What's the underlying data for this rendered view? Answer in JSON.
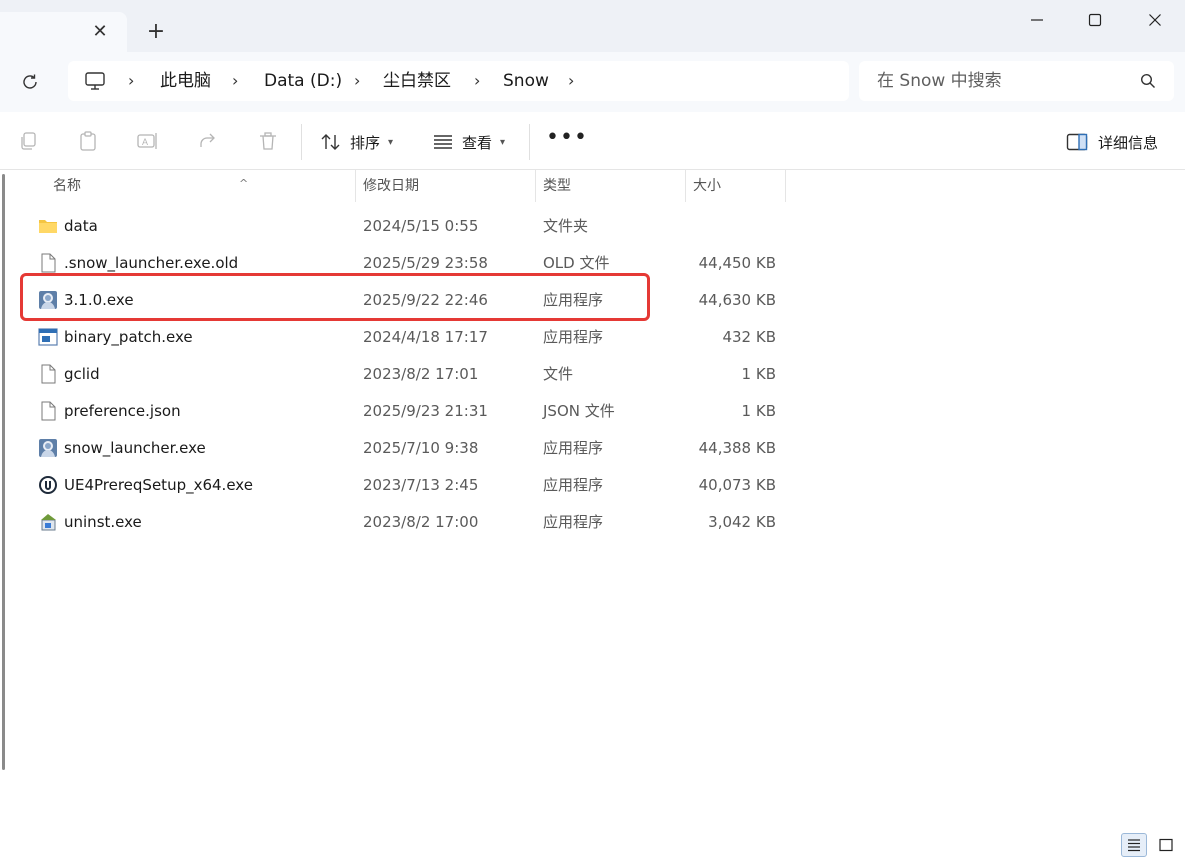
{
  "window": {
    "tab_close_glyph": "✕",
    "new_tab_glyph": "+",
    "controls": [
      "minimize-icon",
      "maximize-icon",
      "close-icon"
    ]
  },
  "breadcrumb": {
    "items": [
      "此电脑",
      "Data (D:)",
      "尘白禁区",
      "Snow"
    ],
    "separator": "›"
  },
  "search": {
    "placeholder": "在 Snow 中搜索"
  },
  "toolbar": {
    "icons": [
      "copy-icon",
      "paste-icon",
      "rename-icon",
      "share-icon",
      "delete-icon"
    ],
    "sort_label": "排序",
    "view_label": "查看",
    "more_label": "•••",
    "details_label": "详细信息"
  },
  "columns": {
    "name": "名称",
    "date": "修改日期",
    "type": "类型",
    "size": "大小"
  },
  "files": [
    {
      "name": "data",
      "date": "2024/5/15 0:55",
      "type": "文件夹",
      "size": "",
      "icon": "folder-icon"
    },
    {
      "name": ".snow_launcher.exe.old",
      "date": "2025/5/29 23:58",
      "type": "OLD 文件",
      "size": "44,450 KB",
      "icon": "file-icon"
    },
    {
      "name": "3.1.0.exe",
      "date": "2025/9/22 22:46",
      "type": "应用程序",
      "size": "44,630 KB",
      "icon": "launcher-app-icon"
    },
    {
      "name": "binary_patch.exe",
      "date": "2024/4/18 17:17",
      "type": "应用程序",
      "size": "432 KB",
      "icon": "window-app-icon"
    },
    {
      "name": "gclid",
      "date": "2023/8/2 17:01",
      "type": "文件",
      "size": "1 KB",
      "icon": "file-icon"
    },
    {
      "name": "preference.json",
      "date": "2025/9/23 21:31",
      "type": "JSON 文件",
      "size": "1 KB",
      "icon": "file-icon"
    },
    {
      "name": "snow_launcher.exe",
      "date": "2025/7/10 9:38",
      "type": "应用程序",
      "size": "44,388 KB",
      "icon": "launcher-app-icon"
    },
    {
      "name": "UE4PrereqSetup_x64.exe",
      "date": "2023/7/13 2:45",
      "type": "应用程序",
      "size": "40,073 KB",
      "icon": "unreal-icon"
    },
    {
      "name": "uninst.exe",
      "date": "2023/8/2 17:00",
      "type": "应用程序",
      "size": "3,042 KB",
      "icon": "uninstaller-icon"
    }
  ],
  "highlight": {
    "row": "3.1.0.exe",
    "color": "#e53935"
  },
  "colors": {
    "tabstrip_bg": "#eef1f6",
    "address_row_bg": "#f7f9fc",
    "folder_yellow": "#f4c542"
  }
}
